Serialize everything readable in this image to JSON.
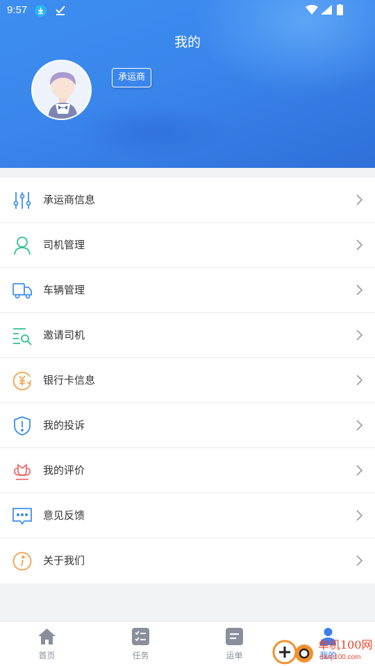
{
  "status_bar": {
    "time": "9:57"
  },
  "header": {
    "title": "我的",
    "role_badge": "承运商"
  },
  "menu": [
    {
      "label": "承运商信息",
      "icon": "sliders-icon",
      "color": "#3c8df0"
    },
    {
      "label": "司机管理",
      "icon": "driver-icon",
      "color": "#2cc38a"
    },
    {
      "label": "车辆管理",
      "icon": "truck-icon",
      "color": "#3c8df0"
    },
    {
      "label": "邀请司机",
      "icon": "search-list-icon",
      "color": "#2cc38a"
    },
    {
      "label": "银行卡信息",
      "icon": "yuan-icon",
      "color": "#f5a04a"
    },
    {
      "label": "我的投诉",
      "icon": "shield-alert-icon",
      "color": "#3c8df0"
    },
    {
      "label": "我的评价",
      "icon": "flower-icon",
      "color": "#f06d6d"
    },
    {
      "label": "意见反馈",
      "icon": "chat-icon",
      "color": "#3c8df0"
    },
    {
      "label": "关于我们",
      "icon": "info-icon",
      "color": "#f5a04a"
    }
  ],
  "tabs": [
    {
      "label": "首页",
      "icon": "home-icon"
    },
    {
      "label": "任务",
      "icon": "task-icon"
    },
    {
      "label": "运单",
      "icon": "waybill-icon"
    },
    {
      "label": "我的",
      "icon": "profile-icon",
      "active": true
    }
  ],
  "watermark": {
    "line1": "单机100网",
    "line2": "danji100.com"
  }
}
